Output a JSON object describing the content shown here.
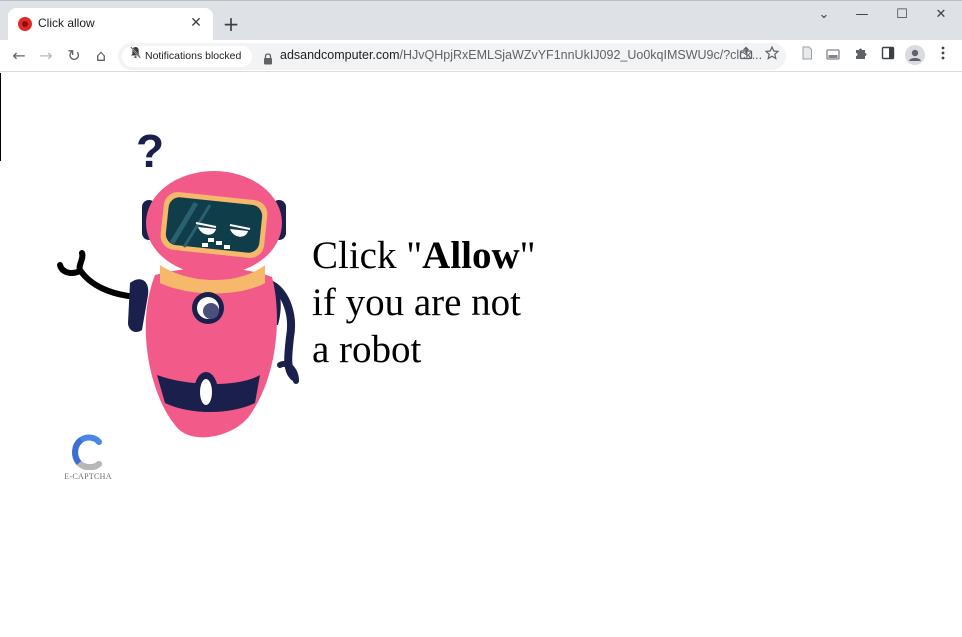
{
  "browser": {
    "tab": {
      "title": "Click allow",
      "close_glyph": "✕"
    },
    "new_tab_glyph": "+",
    "window_controls": {
      "minimize": "—",
      "maximize": "☐",
      "close": "✕",
      "dropdown": "⌄"
    },
    "nav": {
      "back": "←",
      "forward": "→",
      "reload": "↻",
      "home": "⌂"
    },
    "notification_chip": "Notifications blocked",
    "url_domain": "adsandcomputer.com",
    "url_path": "/HJvQHpjRxEMLSjaWZvYF1nnUkIJ092_Uo0kqIMSWU9c/?clck...",
    "icons": {
      "share": "share-icon",
      "bookmark": "star-icon",
      "reader": "document-icon",
      "drive": "drive-icon",
      "extensions": "puzzle-icon",
      "side_panel": "side-panel-icon",
      "profile": "profile-icon",
      "menu": "kebab-menu-icon"
    }
  },
  "page": {
    "headline": {
      "prefix": "Click \"",
      "bold": "Allow",
      "suffix": "\"",
      "line2": "if you are not",
      "line3": "a robot"
    },
    "question_mark": "?",
    "captcha_label": "E-CAPTCHA"
  },
  "colors": {
    "robot_pink": "#f25a8a",
    "robot_navy": "#1b1f4b",
    "robot_collar": "#f6b86b",
    "captcha_blue": "#4a86e8",
    "favicon_red": "#e02a2a"
  }
}
